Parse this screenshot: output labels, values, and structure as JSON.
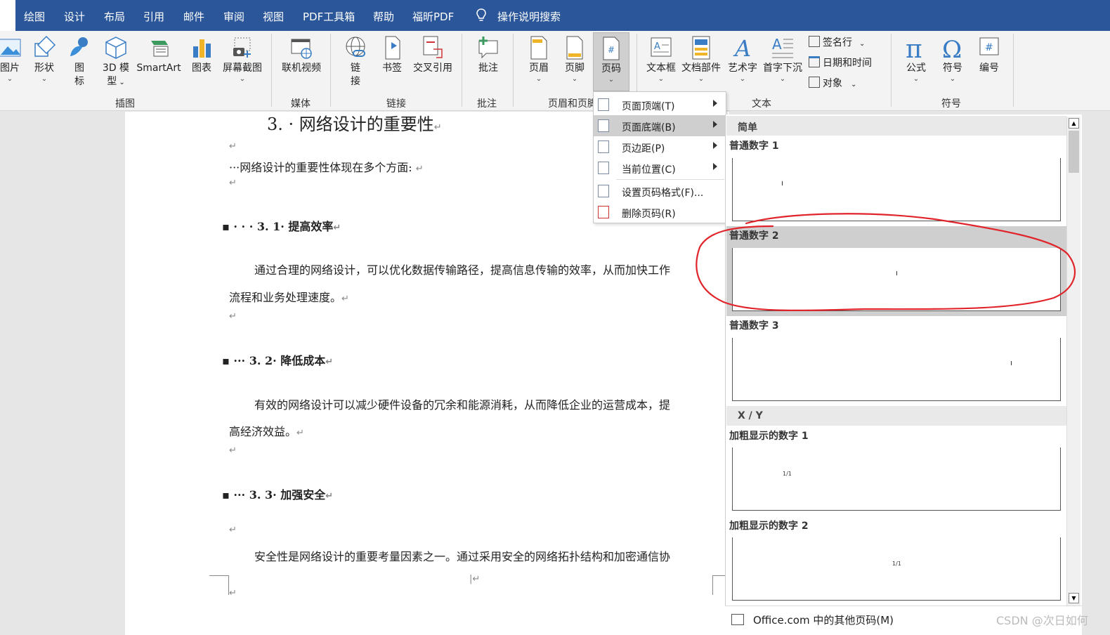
{
  "menu_tabs": [
    "绘图",
    "设计",
    "布局",
    "引用",
    "邮件",
    "审阅",
    "视图",
    "PDF工具箱",
    "帮助",
    "福昕PDF"
  ],
  "search_label": "操作说明搜索",
  "ribbon": {
    "illustrations": {
      "picture": "图片",
      "shapes": "形状",
      "icons_1": "图",
      "icons_2": "标",
      "model_1": "3D 模",
      "model_2": "型",
      "smartart": "SmartArt",
      "chart": "图表",
      "screenshot": "屏幕截图",
      "group": "插图"
    },
    "media": {
      "online_video": "联机视频",
      "group": "媒体"
    },
    "links": {
      "link_1": "链",
      "link_2": "接",
      "bookmark": "书签",
      "crossref": "交叉引用",
      "group": "链接"
    },
    "comments": {
      "comment": "批注",
      "group": "批注"
    },
    "header_footer": {
      "header": "页眉",
      "footer": "页脚",
      "page_number": "页码",
      "group": "页眉和页脚"
    },
    "text": {
      "textbox": "文本框",
      "quickparts": "文档部件",
      "wordart": "艺术字",
      "dropcap": "首字下沉",
      "signature": "签名行",
      "datetime": "日期和时间",
      "object": "对象",
      "group": "文本"
    },
    "symbols": {
      "equation": "公式",
      "symbol": "符号",
      "number": "编号",
      "group": "符号"
    }
  },
  "document": {
    "heading": "3. · 网络设计的重要性",
    "intro": "···网络设计的重要性体现在多个方面:",
    "s1_title": "3. 1· 提高效率",
    "s1_line1": "通过合理的网络设计，可以优化数据传输路径，提高信息传输的效率，从而加快工作",
    "s1_line2": "流程和业务处理速度。",
    "s2_title": "3. 2· 降低成本",
    "s2_line1": "有效的网络设计可以减少硬件设备的冗余和能源消耗，从而降低企业的运营成本，提",
    "s2_line2": "高经济效益。",
    "s3_title": "3. 3· 加强安全",
    "s3_line1": "安全性是网络设计的重要考量因素之一。通过采用安全的网络拓扑结构和加密通信协"
  },
  "page_number_menu": {
    "items": [
      {
        "label": "页面顶端(T)",
        "submenu": true
      },
      {
        "label": "页面底端(B)",
        "submenu": true,
        "highlighted": true
      },
      {
        "label": "页边距(P)",
        "submenu": true
      },
      {
        "label": "当前位置(C)",
        "submenu": true
      },
      {
        "label": "设置页码格式(F)...",
        "submenu": false
      },
      {
        "label": "删除页码(R)",
        "submenu": false
      }
    ]
  },
  "gallery": {
    "section_simple": "简单",
    "plain1": "普通数字 1",
    "plain2": "普通数字 2",
    "plain3": "普通数字 3",
    "section_xy": "X / Y",
    "bold1": "加粗显示的数字 1",
    "bold2": "加粗显示的数字 2",
    "sample_xy": "1/1",
    "more_link": "Office.com 中的其他页码(M)"
  },
  "watermark": "CSDN @次日如何",
  "colors": {
    "ribbon_tab_bg": "#2b579a",
    "annotation": "#e0242a",
    "hover": "#cfcfcf"
  }
}
